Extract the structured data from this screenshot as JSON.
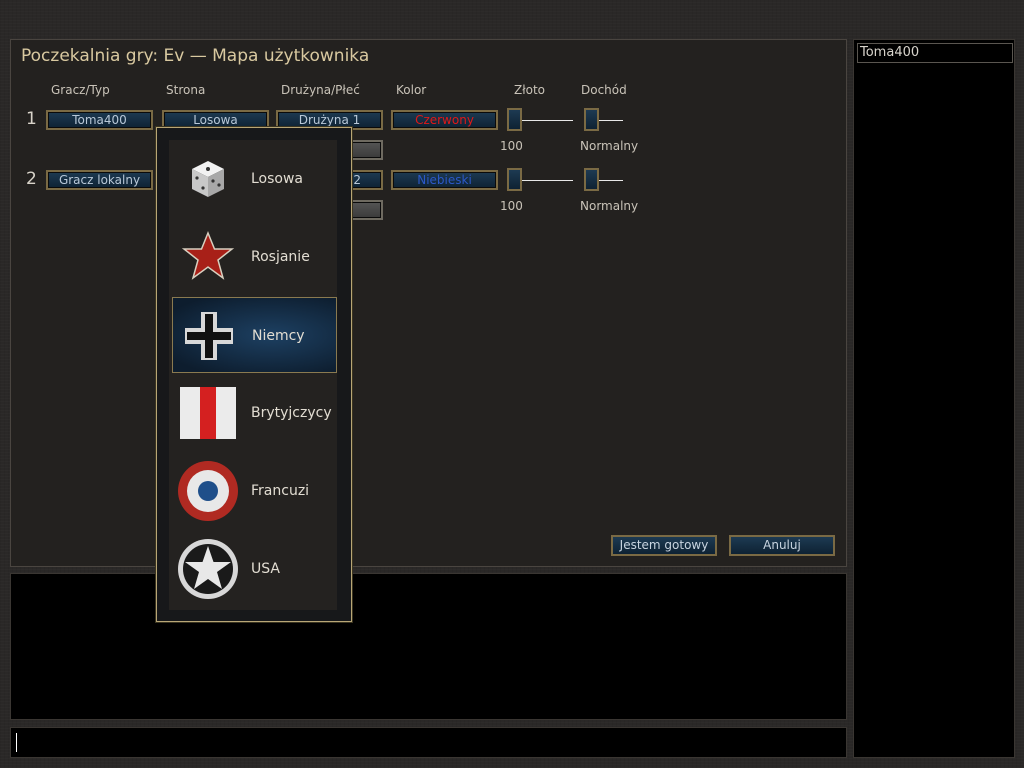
{
  "lobby": {
    "title": "Poczekalnia gry: Ev — Mapa użytkownika",
    "columns": {
      "player": "Gracz/Typ",
      "side": "Strona",
      "team": "Drużyna/Płeć",
      "color": "Kolor",
      "gold": "Złoto",
      "income": "Dochód"
    },
    "rows": [
      {
        "number": "1",
        "player": "Toma400",
        "side": "Losowa",
        "team": "Drużyna 1",
        "color": "Czerwony",
        "color_hex": "#e01818",
        "gold": "100",
        "income": "Normalny"
      },
      {
        "number": "2",
        "player": "Gracz lokalny",
        "side": "",
        "team": "2",
        "color": "Niebieski",
        "color_hex": "#2b58c8",
        "gold": "100",
        "income": "Normalny"
      }
    ],
    "ready_button": "Jestem gotowy",
    "cancel_button": "Anuluj"
  },
  "players_list": [
    "Toma400"
  ],
  "side_dropdown": {
    "selected": "Niemcy",
    "options": [
      {
        "label": "Losowa",
        "icon": "dice-icon"
      },
      {
        "label": "Rosjanie",
        "icon": "red-star-icon"
      },
      {
        "label": "Niemcy",
        "icon": "balkenkreuz-icon"
      },
      {
        "label": "Brytyjczycy",
        "icon": "british-flag-icon"
      },
      {
        "label": "Francuzi",
        "icon": "french-roundel-icon"
      },
      {
        "label": "USA",
        "icon": "us-star-icon"
      }
    ]
  },
  "colors": {
    "accent_border": "#b8a676",
    "button_bg": "#0e2233",
    "panel_bg": "#23211f"
  }
}
